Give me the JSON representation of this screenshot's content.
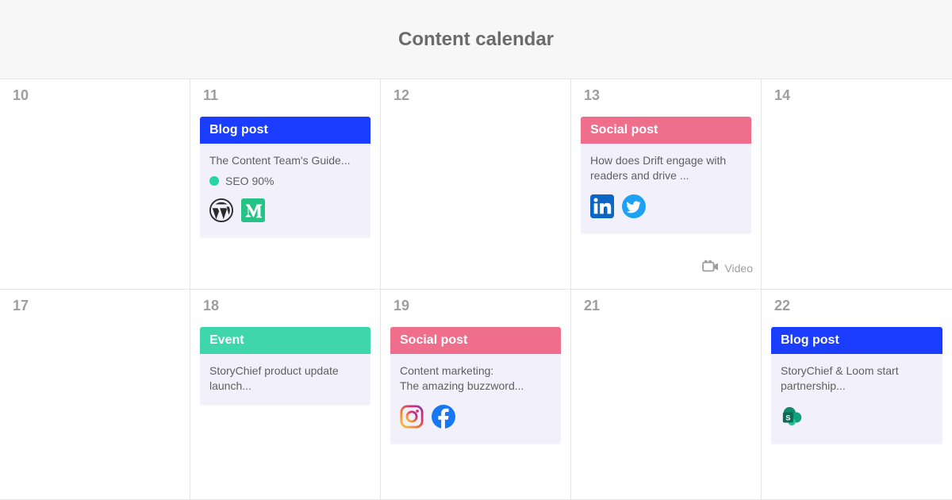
{
  "header": {
    "title": "Content calendar"
  },
  "colors": {
    "blog_post": "#1a3dff",
    "social_post": "#ef6e8c",
    "event": "#3fd6ab",
    "seo_dot": "#24d6a3"
  },
  "days": [
    {
      "number": "10"
    },
    {
      "number": "11",
      "card": {
        "type_label": "Blog post",
        "type_color": "blue",
        "title": "The Content Team's Guide...",
        "seo_label": "SEO 90%",
        "icons": [
          "wordpress",
          "medium"
        ]
      }
    },
    {
      "number": "12"
    },
    {
      "number": "13",
      "card": {
        "type_label": "Social post",
        "type_color": "pink",
        "title": "How does Drift engage with readers and drive ...",
        "icons": [
          "linkedin",
          "twitter"
        ]
      },
      "extra": {
        "icon": "video",
        "label": "Video"
      }
    },
    {
      "number": "14"
    },
    {
      "number": "17"
    },
    {
      "number": "18",
      "card": {
        "type_label": "Event",
        "type_color": "teal",
        "title": "StoryChief product update launch..."
      }
    },
    {
      "number": "19",
      "card": {
        "type_label": "Social post",
        "type_color": "pink",
        "title": "Content marketing:\nThe amazing buzzword...",
        "icons": [
          "instagram",
          "facebook"
        ]
      }
    },
    {
      "number": "21"
    },
    {
      "number": "22",
      "card": {
        "type_label": "Blog post",
        "type_color": "blue",
        "title": "StoryChief & Loom start partnership...",
        "icons": [
          "sharepoint"
        ]
      }
    }
  ]
}
